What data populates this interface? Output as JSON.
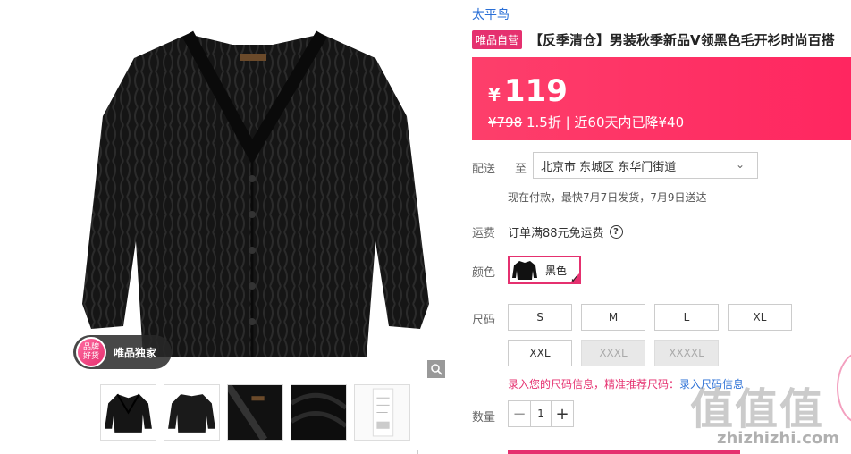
{
  "gallery": {
    "exclusive_circle_line1": "品牌",
    "exclusive_circle_line2": "好货",
    "exclusive_label": "唯品独家"
  },
  "product": {
    "brand": "太平鸟",
    "vip_tag": "唯品自营",
    "title": "【反季清仓】男装秋季新品V领黑色毛开衫时尚百搭"
  },
  "price": {
    "currency": "¥",
    "value": "119",
    "original": "¥798",
    "discount": "1.5折",
    "drop_note": "| 近60天内已降¥40"
  },
  "delivery": {
    "label": "配送",
    "to": "至",
    "address": "北京市 东城区 东华门街道",
    "eta": "现在付款，最快7月7日发货，7月9日送达"
  },
  "shipping": {
    "label": "运费",
    "text": "订单满88元免运费",
    "help": "?"
  },
  "color": {
    "label": "颜色",
    "selected": "黑色"
  },
  "size": {
    "label": "尺码",
    "options": [
      "S",
      "M",
      "L",
      "XL",
      "XXL",
      "XXXL",
      "XXXXL"
    ],
    "recommend_text": "录入您的尺码信息，精准推荐尺码：",
    "recommend_link": "录入尺码信息"
  },
  "quantity": {
    "label": "数量",
    "value": "1",
    "minus": "−",
    "plus": "+"
  },
  "watermark": {
    "text": "值值值",
    "url": "zhizhizhi.com"
  },
  "colors": {
    "accent": "#e5306f",
    "price_bg": "#fd3f6b",
    "link": "#2a6fd6"
  }
}
